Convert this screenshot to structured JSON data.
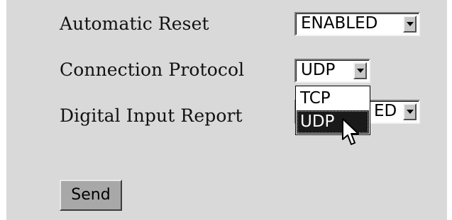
{
  "form": {
    "automatic_reset": {
      "label": "Automatic Reset",
      "value": "ENABLED"
    },
    "connection_protocol": {
      "label": "Connection Protocol",
      "value": "UDP",
      "options": [
        "TCP",
        "UDP"
      ],
      "highlighted_option": "UDP"
    },
    "digital_input_report": {
      "label": "Digital Input Report",
      "value_visible_fragment": "ED"
    },
    "send_label": "Send"
  },
  "icons": {
    "select_arrow": "chevron-down-icon",
    "cursor": "mouse-pointer-icon"
  },
  "colors": {
    "panel_background": "#d9d9d9",
    "send_button": "#a8a8a8",
    "selected_option_background": "#1a1a1a",
    "selected_option_text": "#ffffff"
  }
}
